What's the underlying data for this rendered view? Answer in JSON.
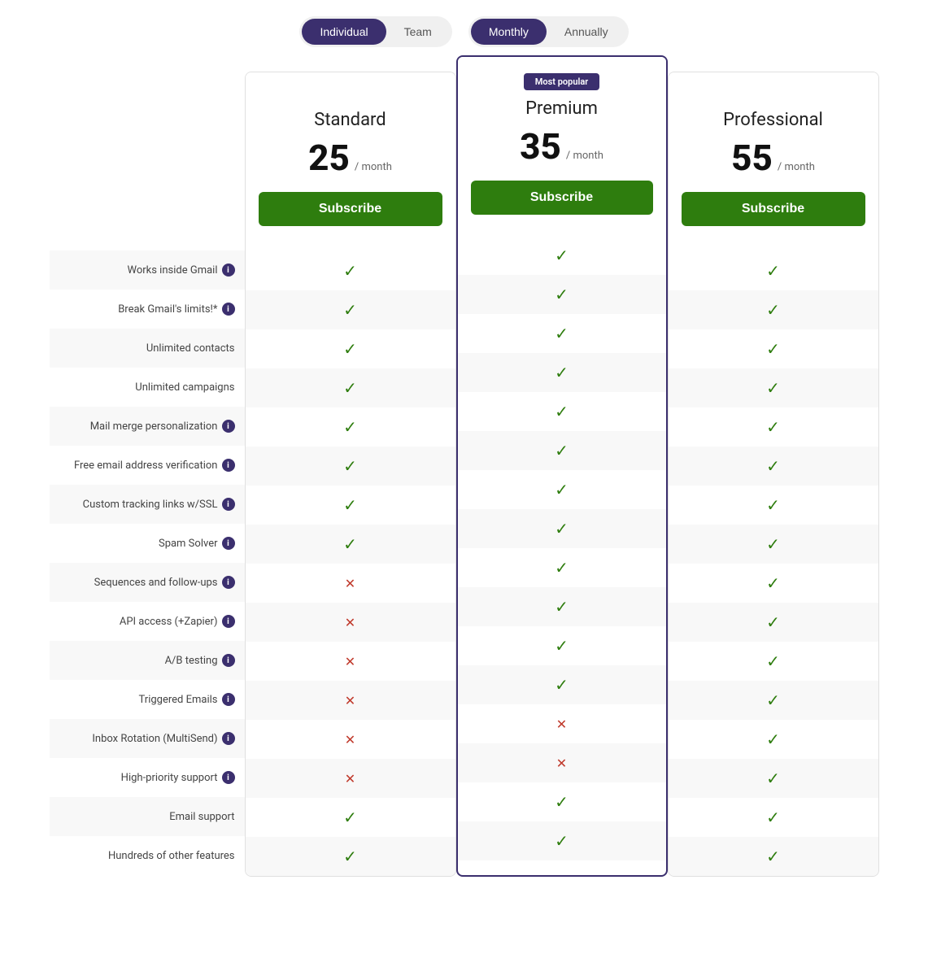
{
  "toggles": {
    "plan_type": {
      "options": [
        "Individual",
        "Team"
      ],
      "active": "Individual"
    },
    "billing": {
      "options": [
        "Monthly",
        "Annually"
      ],
      "active": "Monthly"
    }
  },
  "plans": [
    {
      "id": "standard",
      "name": "Standard",
      "price": "25",
      "period": "/ month",
      "featured": false,
      "badge": null,
      "subscribe_label": "Subscribe"
    },
    {
      "id": "premium",
      "name": "Premium",
      "price": "35",
      "period": "/ month",
      "featured": true,
      "badge": "Most popular",
      "subscribe_label": "Subscribe"
    },
    {
      "id": "professional",
      "name": "Professional",
      "price": "55",
      "period": "/ month",
      "featured": false,
      "badge": null,
      "subscribe_label": "Subscribe"
    }
  ],
  "features": [
    {
      "label": "Works inside Gmail",
      "has_info": true,
      "values": [
        "check",
        "check",
        "check"
      ]
    },
    {
      "label": "Break Gmail's limits!*",
      "has_info": true,
      "values": [
        "check",
        "check",
        "check"
      ]
    },
    {
      "label": "Unlimited contacts",
      "has_info": false,
      "values": [
        "check",
        "check",
        "check"
      ]
    },
    {
      "label": "Unlimited campaigns",
      "has_info": false,
      "values": [
        "check",
        "check",
        "check"
      ]
    },
    {
      "label": "Mail merge personalization",
      "has_info": true,
      "values": [
        "check",
        "check",
        "check"
      ]
    },
    {
      "label": "Free email address verification",
      "has_info": true,
      "values": [
        "check",
        "check",
        "check"
      ]
    },
    {
      "label": "Custom tracking links w/SSL",
      "has_info": true,
      "values": [
        "check",
        "check",
        "check"
      ]
    },
    {
      "label": "Spam Solver",
      "has_info": true,
      "values": [
        "check",
        "check",
        "check"
      ]
    },
    {
      "label": "Sequences and follow-ups",
      "has_info": true,
      "values": [
        "cross",
        "check",
        "check"
      ]
    },
    {
      "label": "API access (+Zapier)",
      "has_info": true,
      "values": [
        "cross",
        "check",
        "check"
      ]
    },
    {
      "label": "A/B testing",
      "has_info": true,
      "values": [
        "cross",
        "check",
        "check"
      ]
    },
    {
      "label": "Triggered Emails",
      "has_info": true,
      "values": [
        "cross",
        "check",
        "check"
      ]
    },
    {
      "label": "Inbox Rotation (MultiSend)",
      "has_info": true,
      "values": [
        "cross",
        "cross",
        "check"
      ]
    },
    {
      "label": "High-priority support",
      "has_info": true,
      "values": [
        "cross",
        "cross",
        "check"
      ]
    },
    {
      "label": "Email support",
      "has_info": false,
      "values": [
        "check",
        "check",
        "check"
      ]
    },
    {
      "label": "Hundreds of other features",
      "has_info": false,
      "values": [
        "check",
        "check",
        "check"
      ]
    }
  ]
}
